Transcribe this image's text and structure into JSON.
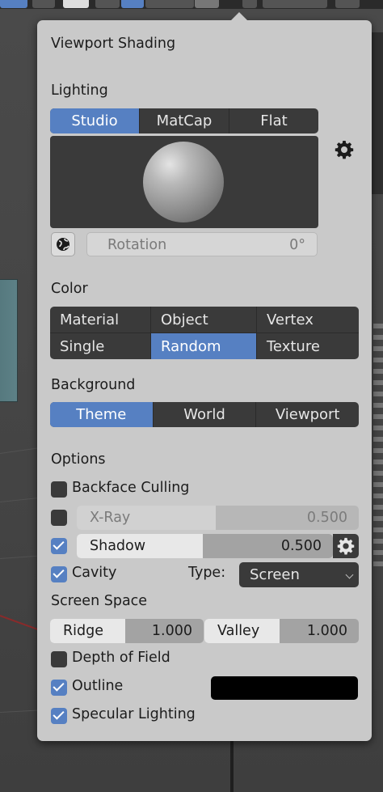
{
  "popover": {
    "title": "Viewport Shading",
    "lighting": {
      "heading": "Lighting",
      "modes": [
        "Studio",
        "MatCap",
        "Flat"
      ],
      "active": "Studio",
      "rotation_label": "Rotation",
      "rotation_value": "0°"
    },
    "color": {
      "heading": "Color",
      "options": [
        "Material",
        "Object",
        "Vertex",
        "Single",
        "Random",
        "Texture"
      ],
      "active": "Random"
    },
    "background": {
      "heading": "Background",
      "options": [
        "Theme",
        "World",
        "Viewport"
      ],
      "active": "Theme"
    },
    "options": {
      "heading": "Options",
      "backface_culling": {
        "label": "Backface Culling",
        "checked": false
      },
      "xray": {
        "label": "X-Ray",
        "value": "0.500",
        "checked": false,
        "enabled": false
      },
      "shadow": {
        "label": "Shadow",
        "value": "0.500",
        "checked": true
      },
      "cavity": {
        "label": "Cavity",
        "checked": true,
        "type_label": "Type:",
        "type_value": "Screen"
      },
      "screen_space": {
        "heading": "Screen Space",
        "ridge_label": "Ridge",
        "ridge_value": "1.000",
        "valley_label": "Valley",
        "valley_value": "1.000"
      },
      "depth_of_field": {
        "label": "Depth of Field",
        "checked": false
      },
      "outline": {
        "label": "Outline",
        "checked": true,
        "color": "#000000"
      },
      "specular_lighting": {
        "label": "Specular Lighting",
        "checked": true
      }
    }
  },
  "colors": {
    "accent": "#5680c2",
    "panel_bg": "#c9c9c9",
    "dark_widget": "#3a3a3a"
  },
  "icons": {
    "world_lighting": "globe-icon",
    "preferences": "gear-icon",
    "shadow_settings": "gear-icon",
    "dropdown": "chevron-down-icon",
    "checkmark": "checkmark-icon"
  }
}
